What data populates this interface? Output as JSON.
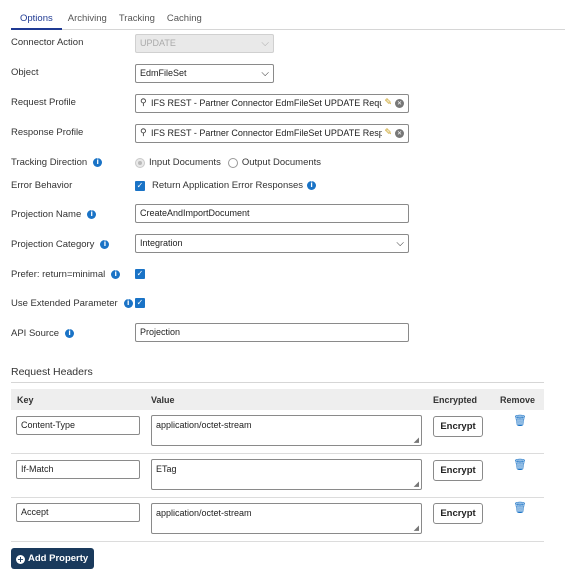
{
  "tabs": [
    "Options",
    "Archiving",
    "Tracking",
    "Caching"
  ],
  "fields": {
    "connector_action": {
      "label": "Connector Action",
      "value": "UPDATE"
    },
    "object": {
      "label": "Object",
      "value": "EdmFileSet"
    },
    "request_profile": {
      "label": "Request Profile",
      "value": "IFS REST - Partner Connector EdmFileSet UPDATE Request"
    },
    "response_profile": {
      "label": "Response Profile",
      "value": "IFS REST - Partner Connector EdmFileSet UPDATE Response"
    },
    "tracking_direction": {
      "label": "Tracking Direction",
      "options": [
        "Input Documents",
        "Output Documents"
      ],
      "selected": "Input Documents"
    },
    "error_behavior": {
      "label": "Error Behavior",
      "checkbox_label": "Return Application Error Responses",
      "checked": true
    },
    "projection_name": {
      "label": "Projection Name",
      "value": "CreateAndImportDocument"
    },
    "projection_category": {
      "label": "Projection Category",
      "value": "Integration"
    },
    "prefer_return_minimal": {
      "label": "Prefer: return=minimal",
      "checked": true
    },
    "use_extended_parameter": {
      "label": "Use Extended Parameter",
      "checked": true
    },
    "api_source": {
      "label": "API Source",
      "value": "Projection"
    }
  },
  "request_headers": {
    "title": "Request Headers",
    "columns": [
      "Key",
      "Value",
      "Encrypted",
      "Remove"
    ],
    "rows": [
      {
        "key": "Content-Type",
        "value": "application/octet-stream",
        "encrypt_label": "Encrypt"
      },
      {
        "key": "If-Match",
        "value": "ETag",
        "encrypt_label": "Encrypt"
      },
      {
        "key": "Accept",
        "value": "application/octet-stream",
        "encrypt_label": "Encrypt"
      }
    ],
    "add_label": "Add Property"
  },
  "icons": {
    "info": "info-icon",
    "search": "search-icon",
    "edit": "pencil-icon",
    "clear": "clear-icon",
    "trash": "trash-icon",
    "add": "plus-circle-icon"
  },
  "colors": {
    "accent": "#1a73c6",
    "tab_active": "#1f3a93",
    "add_button": "#1a3a5c",
    "edit_icon": "#c59a16"
  }
}
